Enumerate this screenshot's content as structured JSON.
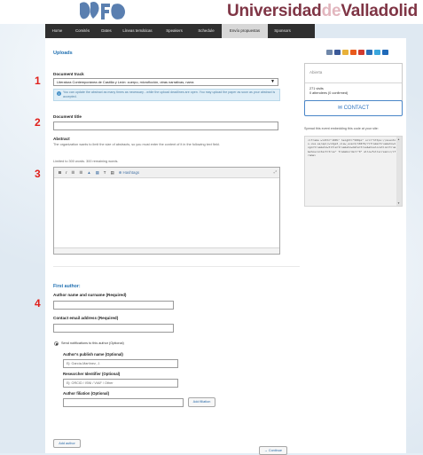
{
  "header": {
    "brand": {
      "part1": "Universidad",
      "part2": "de",
      "part3": "Valladolid"
    },
    "colors": {
      "brand": "#7f3545",
      "brand_light": "#e2b6be",
      "nav_bg": "#2f2f2f",
      "accent": "#1f6fb1",
      "marker": "#e0201b"
    }
  },
  "nav": {
    "tabs": [
      {
        "label": "Home",
        "active": false
      },
      {
        "label": "Comités",
        "active": false
      },
      {
        "label": "Dates",
        "active": false
      },
      {
        "label": "Líneas temáticas",
        "active": false
      },
      {
        "label": "Speakers",
        "active": false
      },
      {
        "label": "Schedule",
        "active": false
      },
      {
        "label": "Envío propuestas",
        "active": true
      },
      {
        "label": "Sponsors",
        "active": false
      }
    ]
  },
  "form": {
    "heading": "Uploads",
    "track_label": "Document track",
    "track_value": "Literatura Contemporánea de Castilla y León: cuerpo, microficción, otras narrativas, narra",
    "info_text": "You can update the abstract as many times as necessary - while the upload deadlines are open. You may upload the paper as soon as your abstract is accepted.",
    "title_label": "Document title",
    "abstract_label": "Abstract",
    "abstract_note": "The organization wants to limit the size of abstracts, so you must enter the content of it in the following text field.",
    "word_limit": "Limited to 300 words. 300 remaining words.",
    "toolbar": [
      "B",
      "I",
      "☰",
      "☰",
      "▲",
      "▦",
      "T",
      "▤"
    ],
    "toolbar_extra": "Hashtags",
    "markers": [
      "1",
      "2",
      "3",
      "4"
    ]
  },
  "author": {
    "heading": "First author:",
    "name_label": "Author name and surname (Required)",
    "email_label": "Contact email address (Required)",
    "notify_label": "Send notifications to this author (Optional)",
    "publish_label": "Author's publish name (Optional)",
    "publish_placeholder": "Ej: García-Martínez, J.",
    "researcher_label": "Researcher Identifier (Optional)",
    "researcher_placeholder": "Ej: ORCID / ISNI / VIAF / Other",
    "filiation_label": "Author filiation (Optional)",
    "add_filiation": "Add filiation",
    "add_author": "Add author",
    "continue": "→ Continue"
  },
  "sidebar": {
    "status": "Abierta",
    "visits": "271 visits",
    "attendees": "0 attendees (0 confirmed)",
    "contact": "CONTACT",
    "embed_label": "Spread this event embedding this code at your site:",
    "embed_code": "<iframe width=\"100%\" height=\"500px\" src=\"https://eventos.uva.es/api/widget_view_event/10479/?iframe=true&showlogo=true&showtitle=true&showdate=true&showlocation=true&showcontact=true\" frameborder=\"0\" allowfullscreen></iframe>",
    "share_colors": [
      "#6f87a9",
      "#3b5998",
      "#e8b13a",
      "#e85a1b",
      "#d13b30",
      "#2a6fb8",
      "#3aa6dd",
      "#1f69b8"
    ]
  }
}
